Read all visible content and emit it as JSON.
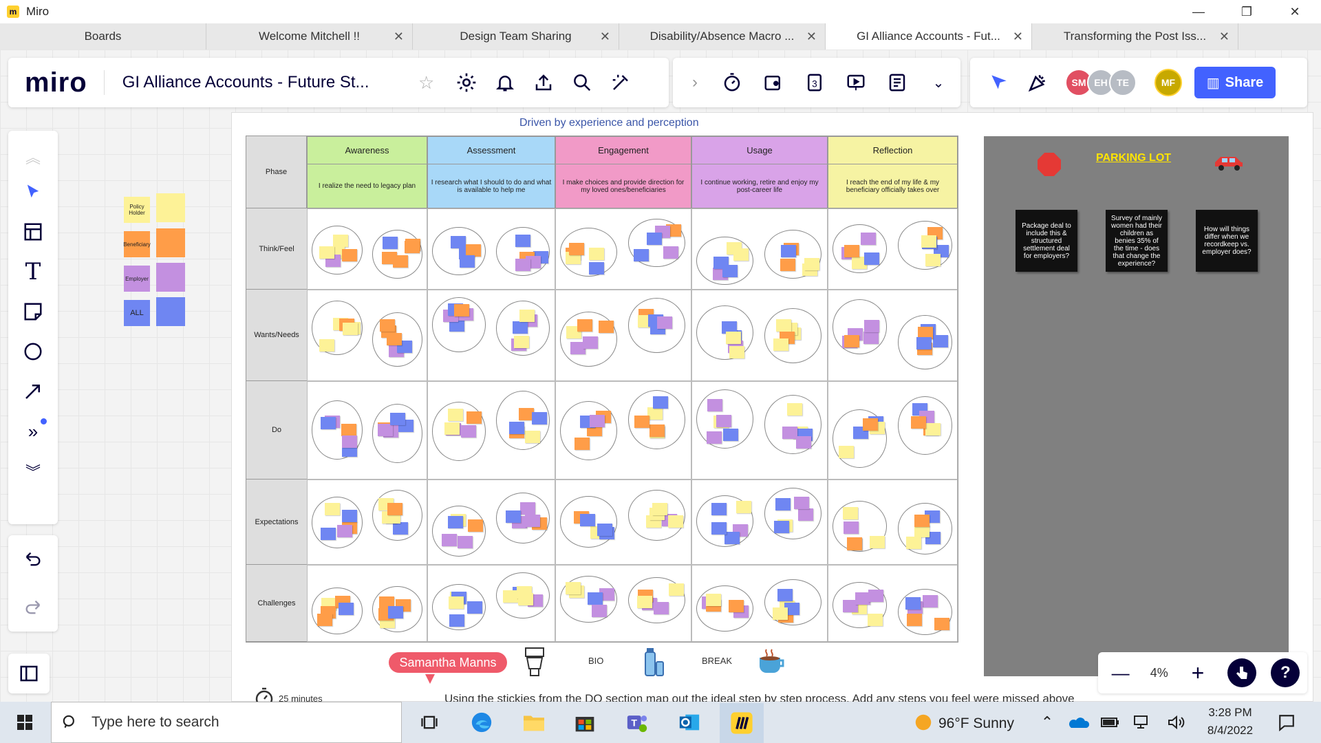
{
  "window": {
    "app_title": "Miro",
    "minimize": "—",
    "maximize": "❐",
    "close": "✕"
  },
  "tabs": [
    {
      "label": "Boards",
      "closable": false
    },
    {
      "label": "Welcome Mitchell !!",
      "closable": true
    },
    {
      "label": "Design Team Sharing",
      "closable": true
    },
    {
      "label": "Disability/Absence Macro ...",
      "closable": true
    },
    {
      "label": "GI Alliance Accounts - Fut...",
      "closable": true,
      "active": true
    },
    {
      "label": "Transforming the Post Iss...",
      "closable": true
    }
  ],
  "toolbar": {
    "logo": "miro",
    "board_title": "GI Alliance Accounts - Future St...",
    "icons": [
      "star-icon",
      "settings-icon",
      "bell-icon",
      "upload-icon",
      "search-icon",
      "magic-icon"
    ],
    "tools": [
      "chevron-right-icon",
      "timer-icon",
      "card-icon",
      "number-3-icon",
      "presentation-icon",
      "notes-icon",
      "chevron-down-icon"
    ],
    "avatars": [
      {
        "initials": "SM",
        "color": "#e14f62"
      },
      {
        "initials": "EH",
        "color": "#b7bcc4"
      },
      {
        "initials": "TE",
        "color": "#b7bcc4"
      },
      {
        "initials": "MF",
        "color": "#c7a900"
      }
    ],
    "share_label": "Share"
  },
  "sidebar": {
    "tools": [
      "collapse-up-icon",
      "cursor-icon",
      "template-icon",
      "text-icon",
      "sticky-note-icon",
      "shape-icon",
      "arrow-icon",
      "more-tools-icon",
      "expand-down-icon"
    ],
    "undo": "undo-icon",
    "redo": "redo-icon"
  },
  "board": {
    "caption": "Driven by experience and perception",
    "phase_label": "Phase",
    "columns": [
      {
        "name": "Awareness",
        "desc": "I realize the need to legacy plan",
        "color": "#c9ef9c"
      },
      {
        "name": "Assessment",
        "desc": "I research what I should to do and what is available to help me",
        "color": "#a8d8f8"
      },
      {
        "name": "Engagement",
        "desc": "I make choices and provide direction for my loved ones/beneficiaries",
        "color": "#f19ac7"
      },
      {
        "name": "Usage",
        "desc": "I continue working, retire and enjoy my post-career life",
        "color": "#d9a3e8"
      },
      {
        "name": "Reflection",
        "desc": "I reach the end of my life & my beneficiary officially takes over",
        "color": "#f6f3a3"
      }
    ],
    "rows": [
      "Think/Feel",
      "Wants/Needs",
      "Do",
      "Expectations",
      "Challenges"
    ]
  },
  "parking_lot": {
    "title": "PARKING LOT",
    "notes": [
      "Package deal to include this & structured settlement deal for employers?",
      "Survey of mainly women had their children as benies 35% of the time - does that change the experience?",
      "How will things differ when we recordkeep vs. employer does?"
    ]
  },
  "legend": [
    {
      "label": "Policy Holder",
      "color": "#fdf297"
    },
    {
      "label": "Beneficiary",
      "color": "#ff9d48"
    },
    {
      "label": "Employer",
      "color": "#c390e0"
    },
    {
      "label": "ALL",
      "color": "#6f86f2"
    }
  ],
  "presenter": "Samantha Manns",
  "bottom_labels": {
    "bio": "BIO",
    "break": "BREAK",
    "timer": "25 minutes"
  },
  "instruction": "Using the stickies from the DO section map out the ideal step by step process. Add any steps you feel were missed above",
  "zoom": {
    "level": "4%",
    "minus": "—",
    "plus": "+",
    "help": "?"
  },
  "taskbar": {
    "search_placeholder": "Type here to search",
    "weather": "96°F  Sunny",
    "time": "3:28 PM",
    "date": "8/4/2022"
  }
}
